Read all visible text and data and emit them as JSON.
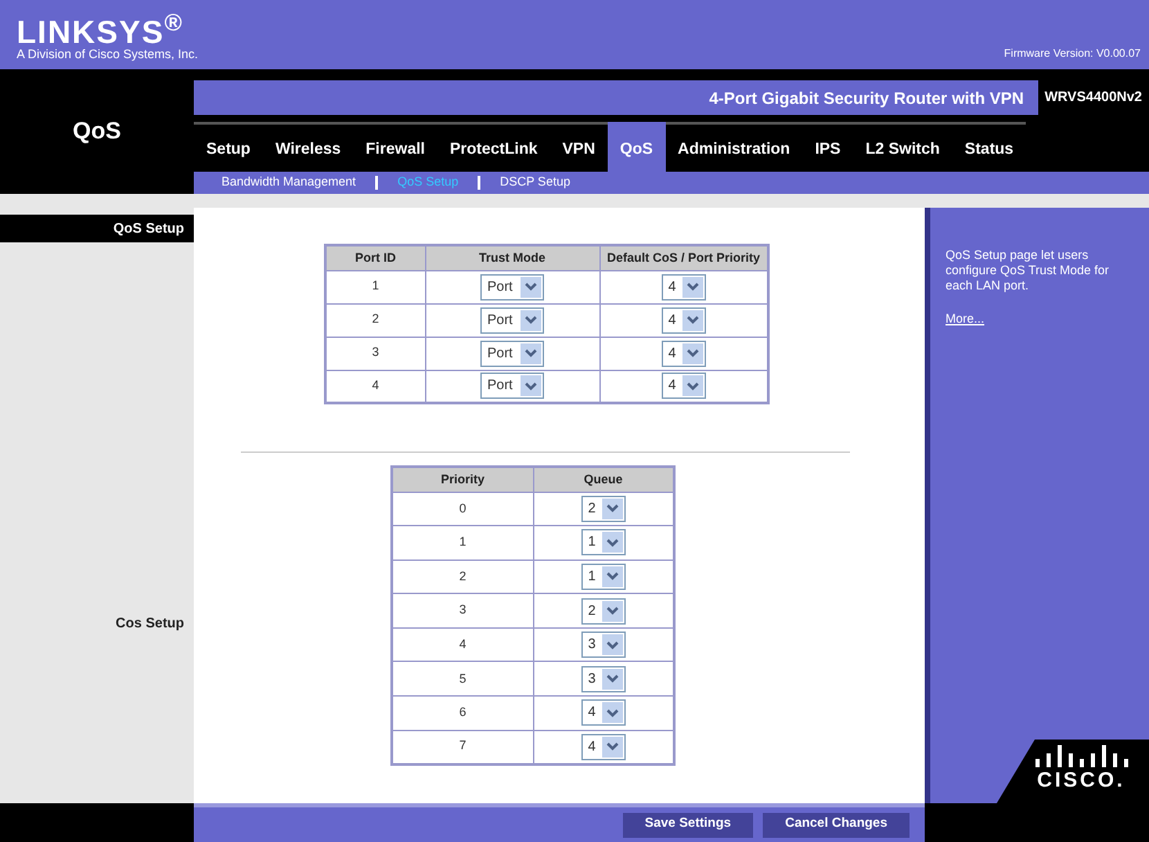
{
  "header": {
    "logo": "LINKSYS$^{®}$",
    "tagline": "A Division of Cisco Systems, Inc.",
    "firmware": "Firmware Version: V0.00.07"
  },
  "section_title": "QoS",
  "product": {
    "name": "4-Port Gigabit Security Router with VPN",
    "model": "WRVS4400Nv2"
  },
  "tabs": [
    {
      "label": "Setup",
      "selected": false
    },
    {
      "label": "Wireless",
      "selected": false
    },
    {
      "label": "Firewall",
      "selected": false
    },
    {
      "label": "ProtectLink",
      "selected": false
    },
    {
      "label": "VPN",
      "selected": false
    },
    {
      "label": "QoS",
      "selected": true
    },
    {
      "label": "Administration",
      "selected": false
    },
    {
      "label": "IPS",
      "selected": false
    },
    {
      "label": "L2 Switch",
      "selected": false
    },
    {
      "label": "Status",
      "selected": false
    }
  ],
  "subtabs": [
    {
      "label": "Bandwidth Management",
      "selected": false
    },
    {
      "label": "QoS Setup",
      "selected": true
    },
    {
      "label": "DSCP Setup",
      "selected": false
    }
  ],
  "sections": [
    {
      "label": "QoS Setup"
    },
    {
      "label": "Cos Setup"
    }
  ],
  "port_table": {
    "columns": [
      "Port ID",
      "Trust Mode",
      "Default CoS / Port Priority"
    ],
    "rows": [
      {
        "port": "1",
        "trust_mode": "Port",
        "priority": "4"
      },
      {
        "port": "2",
        "trust_mode": "Port",
        "priority": "4"
      },
      {
        "port": "3",
        "trust_mode": "Port",
        "priority": "4"
      },
      {
        "port": "4",
        "trust_mode": "Port",
        "priority": "4"
      }
    ]
  },
  "cos_table": {
    "columns": [
      "Priority",
      "Queue"
    ],
    "rows": [
      {
        "priority": "0",
        "queue": "2"
      },
      {
        "priority": "1",
        "queue": "1"
      },
      {
        "priority": "2",
        "queue": "1"
      },
      {
        "priority": "3",
        "queue": "2"
      },
      {
        "priority": "4",
        "queue": "3"
      },
      {
        "priority": "5",
        "queue": "3"
      },
      {
        "priority": "6",
        "queue": "4"
      },
      {
        "priority": "7",
        "queue": "4"
      }
    ]
  },
  "help": {
    "text": "QoS Setup page let users configure QoS Trust Mode for each LAN port.",
    "link": "More..."
  },
  "buttons": [
    "Save Settings",
    "Cancel Changes"
  ],
  "footer_logo": "CISCO."
}
